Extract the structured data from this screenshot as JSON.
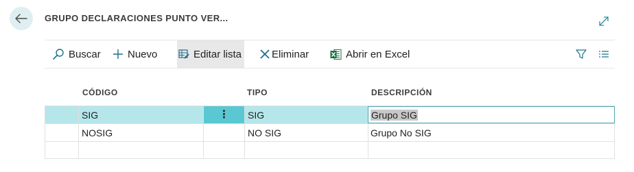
{
  "header": {
    "title": "GRUPO DECLARACIONES PUNTO VER..."
  },
  "toolbar": {
    "search_label": "Buscar",
    "new_label": "Nuevo",
    "edit_list_label": "Editar lista",
    "delete_label": "Eliminar",
    "excel_label": "Abrir en Excel"
  },
  "colors": {
    "accent": "#5ac8d2",
    "selected_row": "#b5e6ea",
    "excel_green": "#1e7145"
  },
  "table": {
    "columns": [
      "CÓDIGO",
      "TIPO",
      "DESCRIPCIÓN"
    ],
    "rows": [
      {
        "codigo": "SIG",
        "tipo": "SIG",
        "descripcion": "Grupo SIG",
        "selected": true
      },
      {
        "codigo": "NOSIG",
        "tipo": "NO SIG",
        "descripcion": "Grupo No SIG",
        "selected": false
      },
      {
        "codigo": "",
        "tipo": "",
        "descripcion": "",
        "selected": false
      }
    ],
    "row_menu_glyph": "⋮"
  }
}
